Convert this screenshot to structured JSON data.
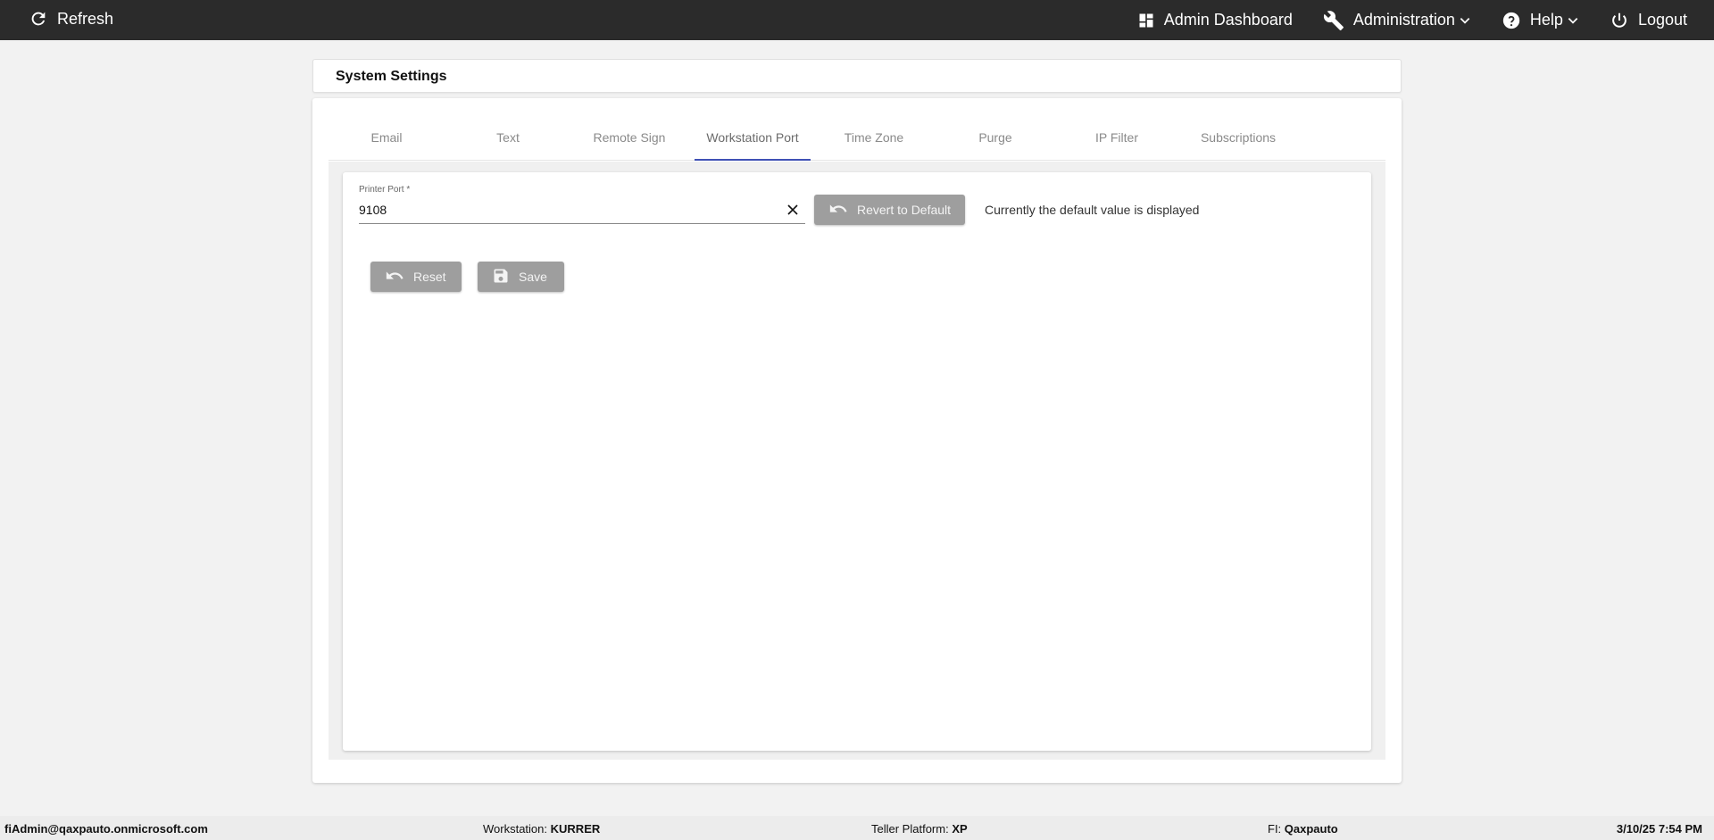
{
  "topbar": {
    "refresh_label": "Refresh",
    "admin_dashboard_label": "Admin Dashboard",
    "administration_label": "Administration",
    "help_label": "Help",
    "logout_label": "Logout"
  },
  "page": {
    "title": "System Settings"
  },
  "tabs": [
    {
      "label": "Email"
    },
    {
      "label": "Text"
    },
    {
      "label": "Remote Sign"
    },
    {
      "label": "Workstation Port",
      "active": true
    },
    {
      "label": "Time Zone"
    },
    {
      "label": "Purge"
    },
    {
      "label": "IP Filter"
    },
    {
      "label": "Subscriptions"
    }
  ],
  "form": {
    "printer_port_label": "Printer Port *",
    "printer_port_value": "9108",
    "revert_label": "Revert to Default",
    "hint": "Currently the default value is displayed",
    "reset_label": "Reset",
    "save_label": "Save"
  },
  "footer": {
    "user": "fiAdmin@qaxpauto.onmicrosoft.com",
    "workstation_label": "Workstation:",
    "workstation_value": "KURRER",
    "platform_label": "Teller Platform:",
    "platform_value": "XP",
    "fi_label": "FI:",
    "fi_value": "Qaxpauto",
    "datetime": "3/10/25 7:54 PM"
  },
  "colors": {
    "topbar_bg": "#2b2b2b",
    "tab_indicator": "#3f51b5",
    "button_bg": "#9e9e9e"
  },
  "icons": [
    "refresh-icon",
    "dashboard-icon",
    "wrench-icon",
    "help-icon",
    "chevron-down-icon",
    "power-icon",
    "close-icon",
    "undo-icon",
    "floppy-disk-icon"
  ]
}
